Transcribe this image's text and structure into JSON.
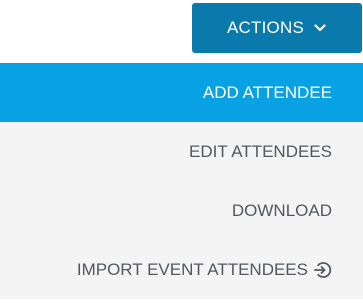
{
  "actions_button": {
    "label": "ACTIONS",
    "icon": "chevron-down-icon"
  },
  "menu": {
    "items": [
      {
        "label": "ADD ATTENDEE",
        "active": true
      },
      {
        "label": "EDIT ATTENDEES",
        "active": false
      },
      {
        "label": "DOWNLOAD",
        "active": false
      },
      {
        "label": "IMPORT EVENT ATTENDEES",
        "active": false,
        "icon": "import-arrow-circle-icon"
      }
    ]
  },
  "colors": {
    "button_bg": "#0a7aad",
    "active_bg": "#08a1e3",
    "menu_bg": "#f4f4f4",
    "text": "#53585f"
  }
}
